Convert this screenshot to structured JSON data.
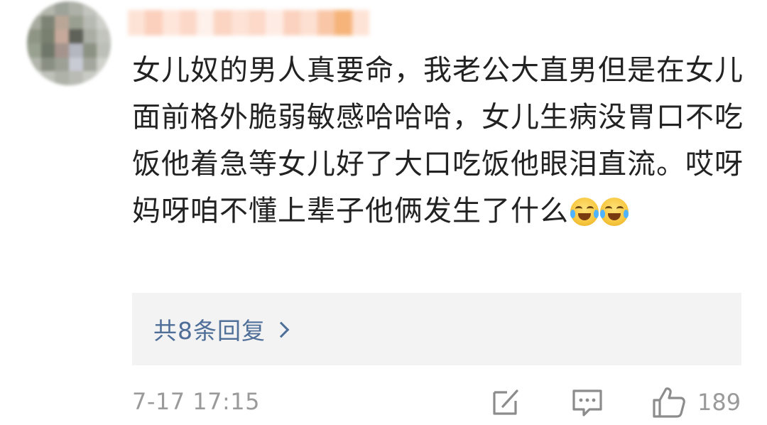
{
  "comment": {
    "username_label": "",
    "text": "女儿奴的男人真要命，我老公大直男但是在女儿面前格外脆弱敏感哈哈哈，女儿生病没胃口不吃饭他着急等女儿好了大口吃饭他眼泪直流。哎呀妈呀咱不懂上辈子他俩发生了什么",
    "emojis": [
      "laugh-cry-emoji",
      "laugh-cry-emoji"
    ]
  },
  "replies": {
    "label": "共8条回复"
  },
  "footer": {
    "timestamp": "7-17 17:15",
    "like_count": "189"
  },
  "icons": {
    "repost": "edit-square-icon",
    "comment": "comment-bubble-icon",
    "like": "thumbs-up-icon",
    "more": "chevron-right-icon"
  },
  "colors": {
    "text": "#222222",
    "link": "#4f6f99",
    "meta": "#9a9a9a",
    "reply_box": "#f3f3f3"
  }
}
